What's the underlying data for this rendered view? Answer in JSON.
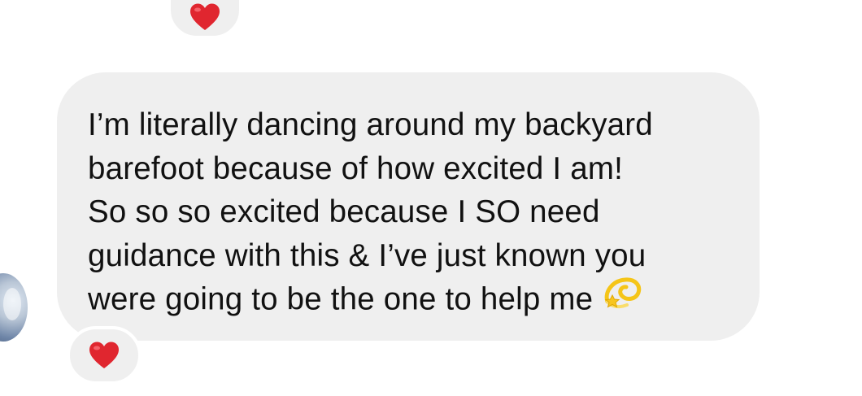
{
  "conversation": {
    "message": {
      "lines": [
        "I’m literally dancing around my backyard",
        "barefoot because of how excited I am!",
        "So so so excited because I SO need",
        "guidance with this & I’ve just known you",
        "were going to be the one to help me"
      ],
      "emoji": "dizzy-emoji"
    },
    "reactions": {
      "previous_message": "red-heart",
      "current_message": "red-heart"
    },
    "colors": {
      "bubble": "#efefef",
      "text": "#111111",
      "heart": "#e0262f",
      "emoji": "#f5c518"
    }
  }
}
